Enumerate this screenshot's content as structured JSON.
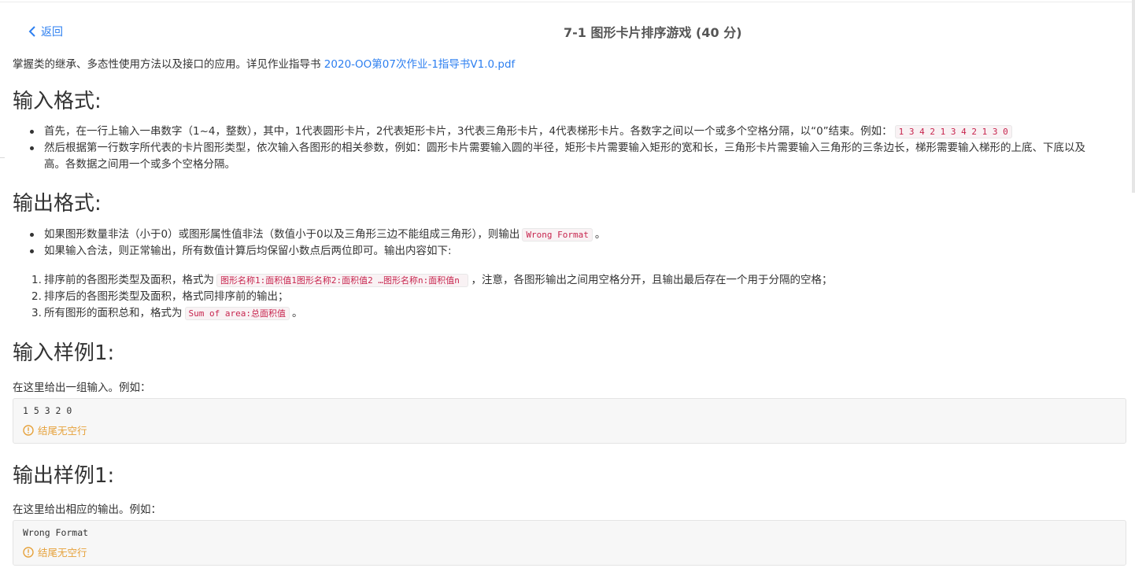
{
  "header": {
    "back_label": "返回",
    "title": "7-1 图形卡片排序游戏 (40 分)"
  },
  "description": {
    "text": "掌握类的继承、多态性使用方法以及接口的应用。详见作业指导书",
    "link_text": "2020-OO第07次作业-1指导书V1.0.pdf"
  },
  "input_format": {
    "heading": "输入格式:",
    "item1_text": "首先，在一行上输入一串数字（1~4，整数），其中，1代表圆形卡片，2代表矩形卡片，3代表三角形卡片，4代表梯形卡片。各数字之间以一个或多个空格分隔，以“0”结束。例如：",
    "item1_code": "1 3 4 2 1 3 4 2 1 3 0",
    "item2_line1": "然后根据第一行数字所代表的卡片图形类型，依次输入各图形的相关参数，例如：圆形卡片需要输入圆的半径，矩形卡片需要输入矩形的宽和长，三角形卡片需要输入三角形的三条边长，梯形需要输入梯形的上底、下底以及",
    "item2_line2": "高。各数据之间用一个或多个空格分隔。"
  },
  "output_format": {
    "heading": "输出格式:",
    "bullet1_pre": "如果图形数量非法（小于0）或图形属性值非法（数值小于0以及三角形三边不能组成三角形），则输出",
    "bullet1_code": "Wrong Format",
    "bullet1_post": "。",
    "bullet2": "如果输入合法，则正常输出，所有数值计算后均保留小数点后两位即可。输出内容如下:",
    "ol1_num": "1.",
    "ol1_pre": "排序前的各图形类型及面积，格式为",
    "ol1_code": "图形名称1:面积值1图形名称2:面积值2 …图形名称n:面积值n ",
    "ol1_post": "，注意，各图形输出之间用空格分开，且输出最后存在一个用于分隔的空格；",
    "ol2_num": "2.",
    "ol2": "排序后的各图形类型及面积，格式同排序前的输出；",
    "ol3_num": "3.",
    "ol3_pre": "所有图形的面积总和，格式为",
    "ol3_code": "Sum of area:总面积值",
    "ol3_post": "。"
  },
  "sample_input": {
    "heading": "输入样例1:",
    "label": "在这里给出一组输入。例如：",
    "code": "1 5 3 2 0",
    "warning": "结尾无空行"
  },
  "sample_output": {
    "heading": "输出样例1:",
    "label": "在这里给出相应的输出。例如：",
    "code": "Wrong Format",
    "warning": "结尾无空行"
  },
  "colors": {
    "link": "#2d7ff0",
    "inline_code": "#c7254e",
    "warning": "#e6a23c"
  }
}
